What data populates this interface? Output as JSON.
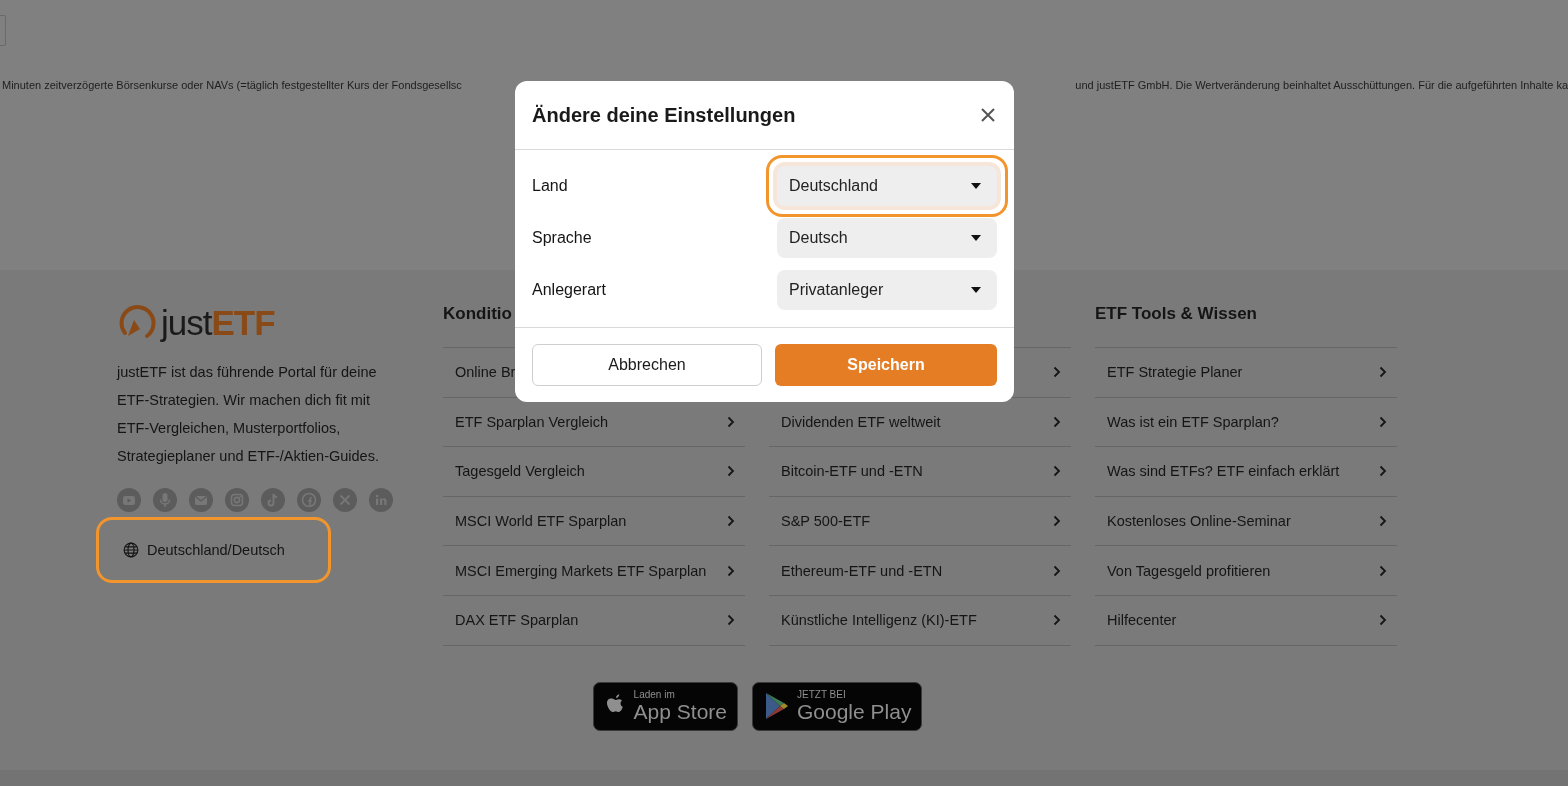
{
  "disclaimer": {
    "left": "Minuten zeitverzögerte Börsenkurse oder NAVs (=täglich festgestellter Kurs der Fondsgesellsc",
    "right": "und justETF GmbH. Die Wertveränderung beinhaltet Ausschüttungen. Für die aufgeführten Inhalte ka"
  },
  "footer": {
    "logo": {
      "prefix": "just",
      "suffix": "ETF"
    },
    "about": "justETF ist das führende Portal für deine ETF-Strategien. Wir machen dich fit mit ETF-Vergleichen, Musterportfolios, Strategieplaner und ETF-/Aktien-Guides.",
    "social": [
      {
        "kind": "youtube"
      },
      {
        "kind": "podcast"
      },
      {
        "kind": "mail"
      },
      {
        "kind": "instagram"
      },
      {
        "kind": "tiktok"
      },
      {
        "kind": "facebook"
      },
      {
        "kind": "x"
      },
      {
        "kind": "linkedin"
      }
    ],
    "locale_link": {
      "label": "Deutschland/Deutsch",
      "highlighted": true
    },
    "columns": [
      {
        "heading": "Konditio",
        "links": [
          {
            "kind": "cut",
            "label": "Online Br"
          },
          {
            "kind": "link",
            "label": "ETF Sparplan Vergleich"
          },
          {
            "kind": "link",
            "label": "Tagesgeld Vergleich"
          },
          {
            "kind": "link",
            "label": "MSCI World ETF Sparplan"
          },
          {
            "kind": "link",
            "label": "MSCI Emerging Markets ETF Sparplan"
          },
          {
            "kind": "link",
            "label": "DAX ETF Sparplan"
          }
        ]
      },
      {
        "links": [
          {
            "kind": "covered"
          },
          {
            "kind": "link",
            "label": "Dividenden ETF weltweit"
          },
          {
            "kind": "link",
            "label": "Bitcoin-ETF und -ETN"
          },
          {
            "kind": "link",
            "label": "S&P 500-ETF"
          },
          {
            "kind": "link",
            "label": "Ethereum-ETF und -ETN"
          },
          {
            "kind": "link",
            "label": "Künstliche Intelligenz (KI)-ETF"
          }
        ]
      },
      {
        "heading": "ETF Tools & Wissen",
        "links": [
          {
            "kind": "link",
            "label": "ETF Strategie Planer"
          },
          {
            "kind": "link",
            "label": "Was ist ein ETF Sparplan?"
          },
          {
            "kind": "link",
            "label": "Was sind ETFs? ETF einfach erklärt"
          },
          {
            "kind": "link",
            "label": "Kostenloses Online-Seminar"
          },
          {
            "kind": "link",
            "label": "Von Tagesgeld profitieren"
          },
          {
            "kind": "link",
            "label": "Hilfecenter"
          }
        ]
      }
    ],
    "badges": [
      {
        "kind": "apple",
        "small": "Laden im",
        "big": "App Store"
      },
      {
        "kind": "google",
        "small": "JETZT BEI",
        "big": "Google Play"
      }
    ]
  },
  "modal": {
    "title": "Ändere deine Einstellungen",
    "fields": [
      {
        "label": "Land",
        "value": "Deutschland",
        "highlighted": true
      },
      {
        "label": "Sprache",
        "value": "Deutsch",
        "highlighted": false
      },
      {
        "label": "Anlegerart",
        "value": "Privatanleger",
        "highlighted": false
      }
    ],
    "buttons": [
      {
        "kind": "secondary",
        "label": "Abbrechen"
      },
      {
        "kind": "primary",
        "label": "Speichern"
      }
    ]
  }
}
